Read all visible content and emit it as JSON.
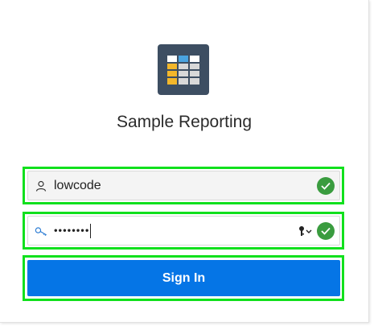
{
  "app": {
    "title": "Sample Reporting",
    "icon": "table-grid-icon"
  },
  "login_form": {
    "username": {
      "value": "lowcode",
      "icon": "user-icon",
      "valid": true
    },
    "password": {
      "masked_value": "••••••••",
      "icon": "key-icon",
      "valid": true
    },
    "sign_in_label": "Sign In"
  },
  "colors": {
    "focus_outline": "#11e01d",
    "button": "#0575e6",
    "app_icon_bg": "#3d4e62",
    "valid_check": "#3a9c3f"
  }
}
